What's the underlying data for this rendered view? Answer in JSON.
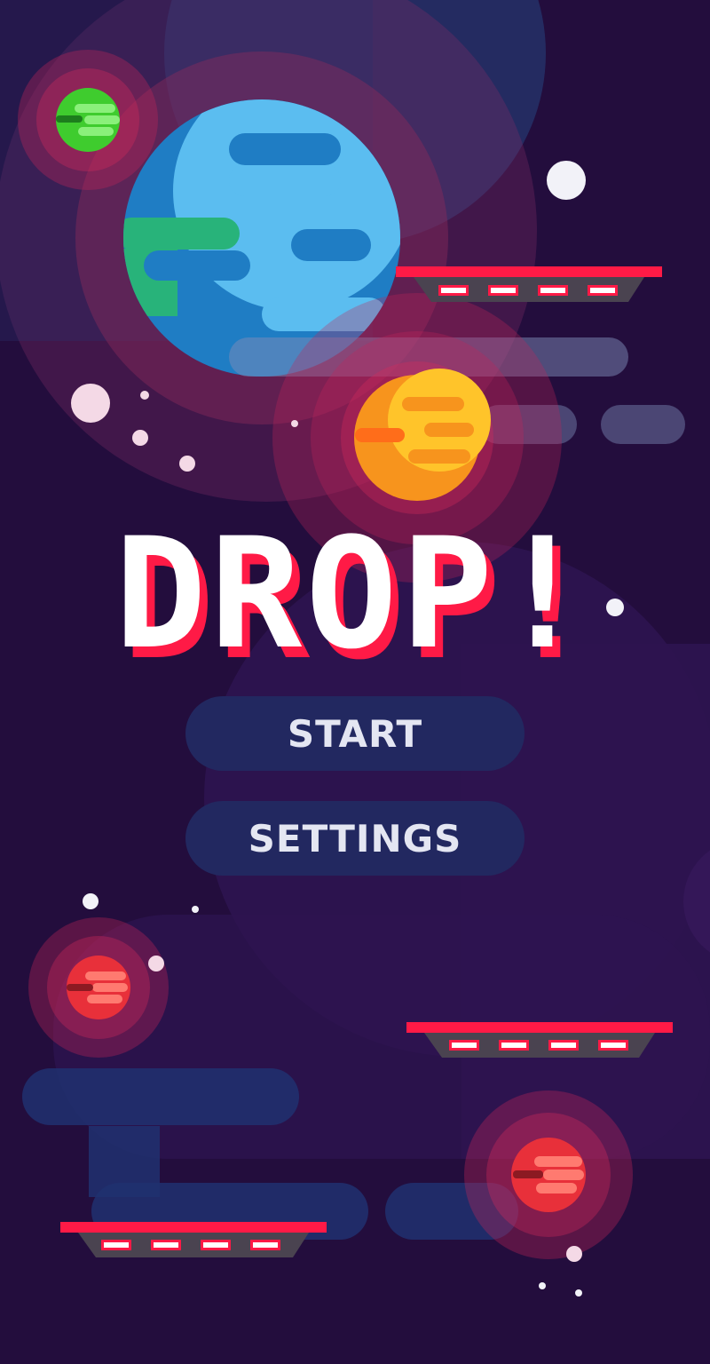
{
  "game": {
    "title": "DROP!",
    "menu": {
      "start_label": "START",
      "settings_label": "SETTINGS"
    }
  },
  "colors": {
    "background": "#230d3d",
    "button_bg": "#222860",
    "button_text": "#e4e6f2",
    "title_fill": "#ffffff",
    "title_shadow": "#ff1a46",
    "platform_top": "#ff1a46",
    "platform_body": "#4a4350",
    "platform_light": "#ffffff"
  },
  "scene": {
    "planets": [
      "earth-planet",
      "green-planet",
      "orange-planet",
      "red-planet",
      "red-planet"
    ],
    "platforms": 3
  }
}
